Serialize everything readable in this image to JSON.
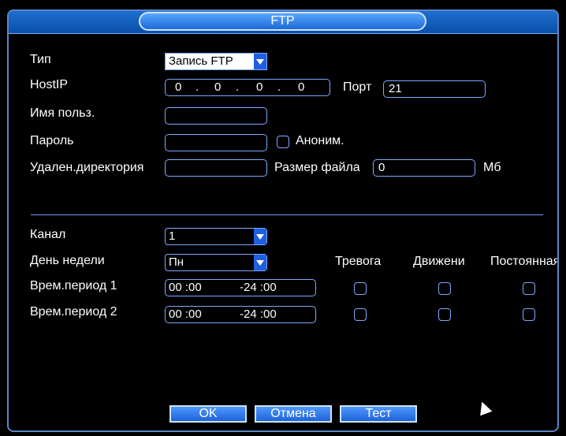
{
  "window": {
    "title": "FTP"
  },
  "form": {
    "type": {
      "label": "Тип",
      "value": "Запись FTP"
    },
    "hostip": {
      "label": "HostIP",
      "octets": [
        "0",
        "0",
        "0",
        "0"
      ],
      "dot": "."
    },
    "port": {
      "label": "Порт",
      "value": "21"
    },
    "username": {
      "label": "Имя польз.",
      "value": ""
    },
    "password": {
      "label": "Пароль",
      "value": ""
    },
    "anonymous": {
      "label": "Аноним.",
      "checked": false
    },
    "remote_dir": {
      "label": "Удален.директория",
      "value": ""
    },
    "file_size": {
      "label": "Размер файла",
      "value": "0",
      "unit": "Мб"
    }
  },
  "schedule": {
    "channel": {
      "label": "Канал",
      "value": "1"
    },
    "weekday": {
      "label": "День недели",
      "value": "Пн"
    },
    "columns": [
      "Тревога",
      "Движени",
      "Постоянная"
    ],
    "periods": [
      {
        "label": "Врем.период 1",
        "start": "00 :00",
        "end": "-24 :00"
      },
      {
        "label": "Врем.период 2",
        "start": "00 :00",
        "end": "-24 :00"
      }
    ]
  },
  "buttons": {
    "ok": "OK",
    "cancel": "Отмена",
    "test": "Тест"
  },
  "colors": {
    "accent": "#1f63d8",
    "border": "#7fa9ff"
  }
}
